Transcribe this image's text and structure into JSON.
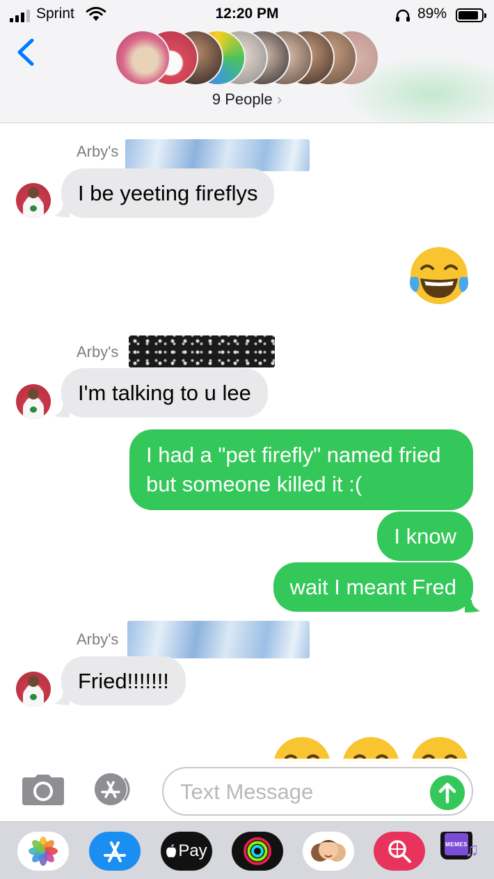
{
  "status_bar": {
    "carrier": "Sprint",
    "time": "12:20 PM",
    "battery_percent": "89%",
    "battery_level": 0.89,
    "signal_bars": 3
  },
  "header": {
    "participants_label": "9 People",
    "chevron": "›",
    "participant_count": 9
  },
  "messages": [
    {
      "sender": "Arby's",
      "direction": "incoming",
      "text": "I be yeeting fireflys"
    },
    {
      "direction": "outgoing",
      "emoji": "😂"
    },
    {
      "sender": "Arby's",
      "direction": "incoming",
      "text": "I'm talking to u lee"
    },
    {
      "direction": "outgoing",
      "text": "I had a \"pet firefly\" named fried but someone killed it :("
    },
    {
      "direction": "outgoing",
      "text": "I know"
    },
    {
      "direction": "outgoing",
      "text": "wait I meant Fred"
    },
    {
      "sender": "Arby's",
      "direction": "incoming",
      "text": "Fried!!!!!!!"
    },
    {
      "direction": "outgoing",
      "emoji": "😂😂😂"
    }
  ],
  "input": {
    "placeholder": "Text Message"
  },
  "app_drawer": {
    "apps": [
      "photos-icon",
      "app-store-icon",
      "apple-pay-icon",
      "activity-icon",
      "memoji-icon",
      "web-search-icon",
      "memes-icon"
    ],
    "apple_pay_label": "Pay",
    "memes_label": "MEMES"
  },
  "colors": {
    "imessage_green": "#34c759",
    "incoming_bubble": "#e9e9eb",
    "ios_blue": "#007aff"
  }
}
